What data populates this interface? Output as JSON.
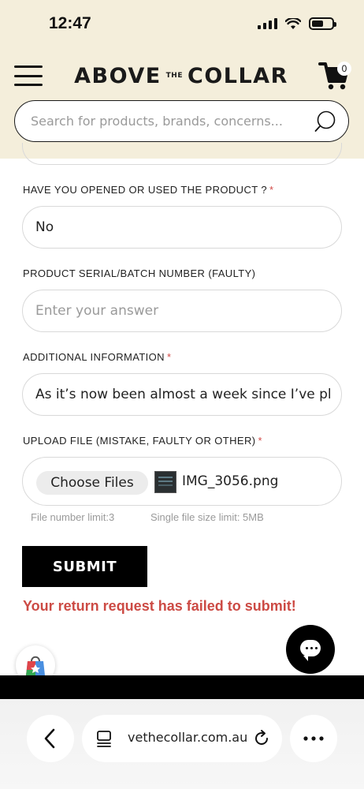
{
  "status_bar": {
    "time": "12:47"
  },
  "header": {
    "logo_left": "ABOVE",
    "logo_small": "THE",
    "logo_right": "COLLAR",
    "cart_count": "0",
    "search_placeholder": "Search for products, brands, concerns..."
  },
  "form": {
    "opened_label": "HAVE YOU OPENED OR USED THE PRODUCT ?",
    "opened_value": "No",
    "serial_label": "PRODUCT SERIAL/BATCH NUMBER (FAULTY)",
    "serial_placeholder": "Enter your answer",
    "additional_label": "ADDITIONAL INFORMATION",
    "additional_value": "As it’s now been almost a week since I’ve pl",
    "upload_label": "UPLOAD FILE (MISTAKE, FAULTY OR OTHER)",
    "choose_files": "Choose Files",
    "file_name": "IMG_3056.png",
    "file_limit": "File number limit:3",
    "size_limit": "Single file size limit: 5MB",
    "required_mark": "*",
    "submit_label": "SUBMIT",
    "error_message": "Your return request has failed to submit!"
  },
  "browser": {
    "url": "vethecollar.com.au"
  },
  "colors": {
    "header_bg": "#f4eedb",
    "error": "#cc4a44",
    "required": "#d24a47",
    "submit_bg": "#000000"
  }
}
